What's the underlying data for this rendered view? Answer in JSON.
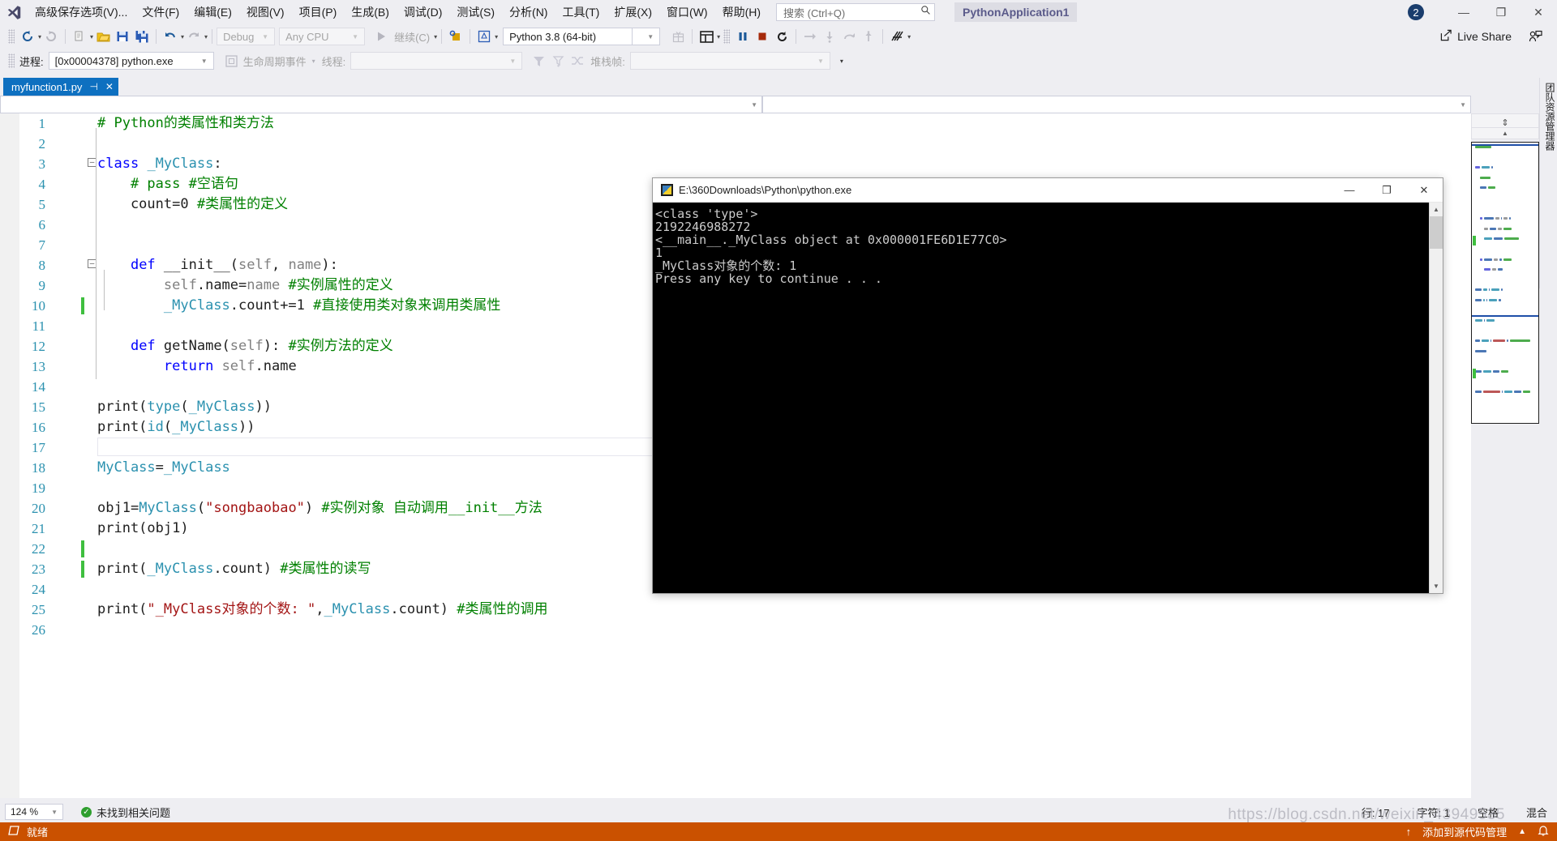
{
  "menu": {
    "logo": "vs-logo",
    "items": [
      "高级保存选项(V)...",
      "文件(F)",
      "编辑(E)",
      "视图(V)",
      "项目(P)",
      "生成(B)",
      "调试(D)",
      "测试(S)",
      "分析(N)",
      "工具(T)",
      "扩展(X)",
      "窗口(W)",
      "帮助(H)"
    ],
    "search_placeholder": "搜索 (Ctrl+Q)",
    "project_chip": "PythonApplication1",
    "notification_count": "2",
    "window_buttons": {
      "minimize": "—",
      "restore": "❐",
      "close": "✕"
    }
  },
  "toolbar": {
    "back": "◀",
    "forward": "▶",
    "new_item": "new-file",
    "open": "open-folder",
    "save": "save",
    "save_all": "save-all",
    "undo": "↶",
    "redo": "↷",
    "config_value": "Debug",
    "platform_value": "Any CPU",
    "continue_label": "继续(C)",
    "attach": "attach-process",
    "env": "python-env",
    "interpreter_value": "Python 3.8 (64-bit)",
    "pause": "pause",
    "stop": "stop",
    "restart": "restart",
    "step_over": "→",
    "step_into": "↓",
    "step_out": "↑",
    "live_share": "Live Share"
  },
  "debugbar": {
    "process_label": "进程:",
    "process_value": "[0x00004378] python.exe",
    "lifecycle_label": "生命周期事件",
    "thread_label": "线程:",
    "thread_value": "",
    "stackframe_label": "堆栈帧:",
    "stackframe_value": ""
  },
  "tab": {
    "filename": "myfunction1.py",
    "pin": "⊣",
    "close": "✕"
  },
  "editor": {
    "lines": [
      {
        "n": "1",
        "fold": "",
        "changed": false,
        "html": "<span class='cm'># Python的类属性和类方法</span>"
      },
      {
        "n": "2",
        "fold": "",
        "changed": false,
        "html": ""
      },
      {
        "n": "3",
        "fold": "minus",
        "changed": false,
        "html": "<span class='kw'>class</span> <span class='kw2'>_MyClass</span><span class='pl'>:</span>"
      },
      {
        "n": "4",
        "fold": "",
        "changed": false,
        "html": "    <span class='cm'># pass #空语句</span>"
      },
      {
        "n": "5",
        "fold": "",
        "changed": false,
        "html": "    count=0 <span class='cm'>#类属性的定义</span>"
      },
      {
        "n": "6",
        "fold": "",
        "changed": false,
        "html": ""
      },
      {
        "n": "7",
        "fold": "",
        "changed": false,
        "html": ""
      },
      {
        "n": "8",
        "fold": "minus",
        "changed": false,
        "html": "    <span class='kw'>def</span> __init__(<span class='pm'>self</span>, <span class='pm'>name</span>):"
      },
      {
        "n": "9",
        "fold": "",
        "changed": false,
        "html": "        <span class='pm'>self</span>.name=<span class='pm'>name</span> <span class='cm'>#实例属性的定义</span>"
      },
      {
        "n": "10",
        "fold": "",
        "changed": true,
        "html": "        <span class='kw2'>_MyClass</span>.count+=1 <span class='cm'>#直接使用类对象来调用类属性</span>"
      },
      {
        "n": "11",
        "fold": "",
        "changed": false,
        "html": ""
      },
      {
        "n": "12",
        "fold": "",
        "changed": false,
        "html": "    <span class='kw'>def</span> getName(<span class='pm'>self</span>): <span class='cm'>#实例方法的定义</span>"
      },
      {
        "n": "13",
        "fold": "",
        "changed": false,
        "html": "        <span class='kw'>return</span> <span class='pm'>self</span>.name"
      },
      {
        "n": "14",
        "fold": "",
        "changed": false,
        "html": ""
      },
      {
        "n": "15",
        "fold": "",
        "changed": false,
        "html": "print(<span class='kw2'>type</span>(<span class='kw2'>_MyClass</span>))"
      },
      {
        "n": "16",
        "fold": "",
        "changed": false,
        "html": "print(<span class='kw2'>id</span>(<span class='kw2'>_MyClass</span>))"
      },
      {
        "n": "17",
        "fold": "",
        "changed": false,
        "html": ""
      },
      {
        "n": "18",
        "fold": "",
        "changed": false,
        "html": "<span class='kw2'>MyClass</span>=<span class='kw2'>_MyClass</span>"
      },
      {
        "n": "19",
        "fold": "",
        "changed": false,
        "html": ""
      },
      {
        "n": "20",
        "fold": "",
        "changed": false,
        "html": "obj1=<span class='kw2'>MyClass</span>(<span class='st'>\"songbaobao\"</span>) <span class='cm'>#实例对象 自动调用__init__方法</span>"
      },
      {
        "n": "21",
        "fold": "",
        "changed": false,
        "html": "print(obj1)"
      },
      {
        "n": "22",
        "fold": "",
        "changed": true,
        "html": ""
      },
      {
        "n": "23",
        "fold": "",
        "changed": true,
        "html": "print(<span class='kw2'>_MyClass</span>.count) <span class='cm'>#类属性的读写</span>"
      },
      {
        "n": "24",
        "fold": "",
        "changed": false,
        "html": ""
      },
      {
        "n": "25",
        "fold": "",
        "changed": false,
        "html": "print(<span class='st'>\"_MyClass对象的个数: \"</span>,<span class='kw2'>_MyClass</span>.count) <span class='cm'>#类属性的调用</span>"
      },
      {
        "n": "26",
        "fold": "",
        "changed": false,
        "html": ""
      }
    ],
    "cursor_line_index": 16
  },
  "console": {
    "title": "E:\\360Downloads\\Python\\python.exe",
    "minimize": "—",
    "maximize": "❐",
    "close": "✕",
    "output": "<class 'type'>\n2192246988272\n<__main__._MyClass object at 0x000001FE6D1E77C0>\n1\n_MyClass对象的个数: 1\nPress any key to continue . . ."
  },
  "right_panel": {
    "vertical_tab": "团队资源管理器"
  },
  "statusbar": {
    "zoom": "124 %",
    "issues": "未找到相关问题",
    "line_label": "行: 17",
    "char_label": "字符: 1",
    "spaces": "空格",
    "encoding": "混合",
    "ready": "就绪",
    "source_control": "添加到源代码管理",
    "up_arrow": "↑",
    "expander": "▲",
    "bell": "🔔"
  },
  "watermark": "https://blog.csdn.net/weixin_43949535",
  "colors": {
    "accent_blue": "#0e70c0",
    "status_orange": "#ca5100",
    "chrome": "#eeeef2",
    "comment_green": "#008000",
    "keyword_blue": "#0000ff",
    "type_teal": "#2b91af",
    "string_red": "#a31515",
    "change_green": "#3fbf3f"
  }
}
